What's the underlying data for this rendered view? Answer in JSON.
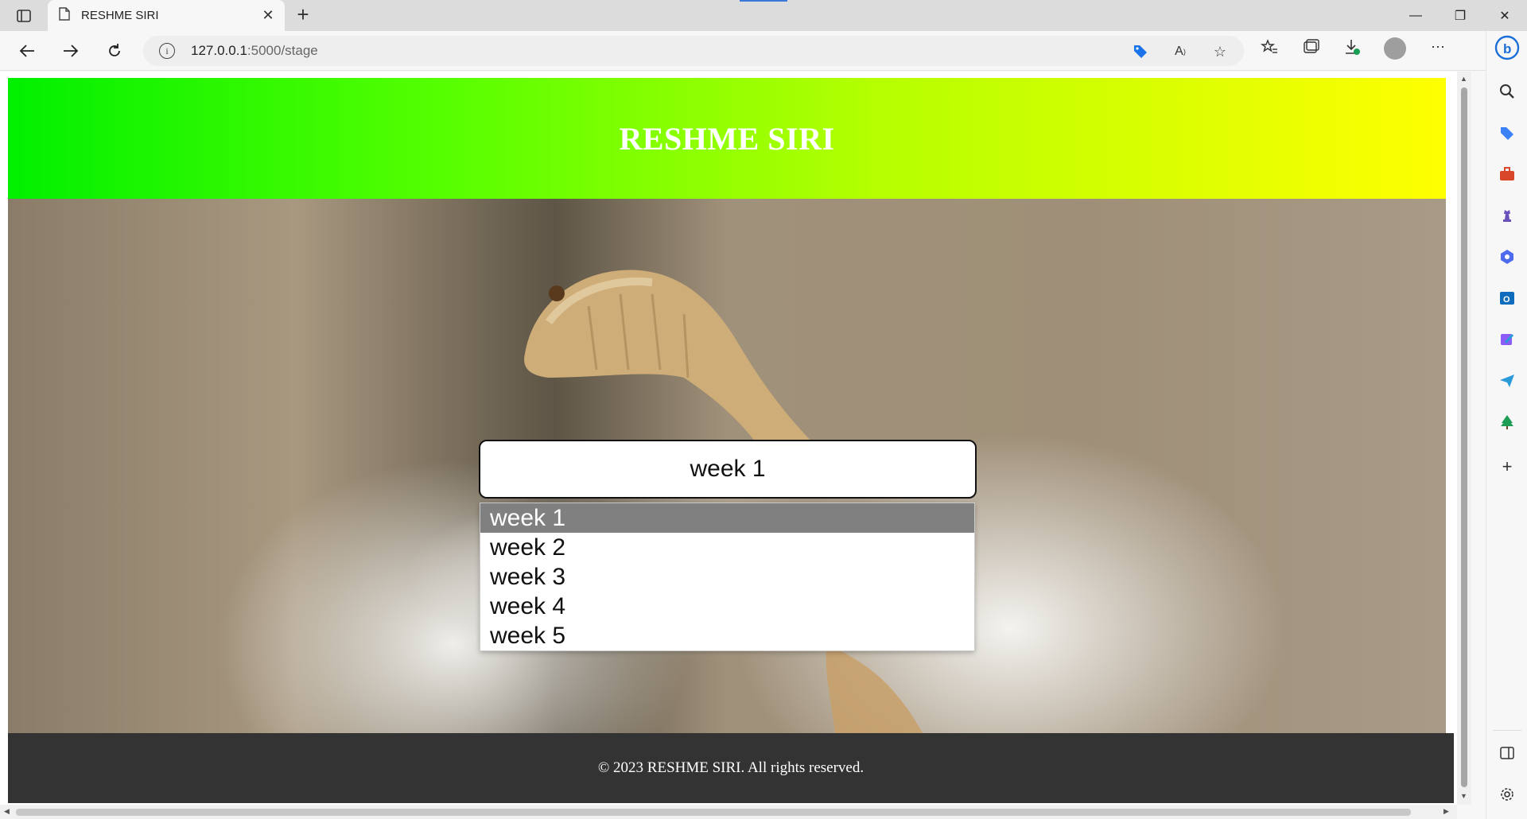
{
  "browser": {
    "tab_title": "RESHME SIRI",
    "url_host": "127.0.0.1",
    "url_rest": ":5000/stage"
  },
  "site": {
    "title": "RESHME SIRI",
    "footer": "© 2023 RESHME SIRI. All rights reserved."
  },
  "stage_search": {
    "value": "week 1",
    "options": [
      "week 1",
      "week 2",
      "week 3",
      "week 4",
      "week 5"
    ],
    "selected_index": 0
  },
  "colors": {
    "header_gradient_start": "#00f000",
    "header_gradient_end": "#ffff00",
    "footer_bg": "#333333",
    "selected_option_bg": "#808080"
  }
}
